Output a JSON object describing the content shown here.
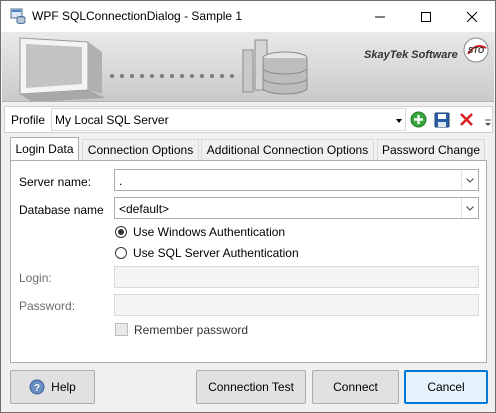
{
  "window": {
    "title": "WPF SQLConnectionDialog - Sample 1",
    "icon": "database-window-icon"
  },
  "banner": {
    "brand": "SkayTek Software",
    "logo_text": "STO"
  },
  "profile": {
    "label": "Profile",
    "value": "My Local SQL Server"
  },
  "tabs": [
    {
      "label": "Login Data",
      "active": true
    },
    {
      "label": "Connection Options",
      "active": false
    },
    {
      "label": "Additional Connection Options",
      "active": false
    },
    {
      "label": "Password Change",
      "active": false
    }
  ],
  "login": {
    "server_label": "Server name:",
    "server_value": ".",
    "database_label": "Database name",
    "database_value": "<default>",
    "auth_windows": "Use Windows Authentication",
    "auth_sql": "Use SQL Server Authentication",
    "login_label": "Login:",
    "login_value": "",
    "password_label": "Password:",
    "password_value": "",
    "remember_label": "Remember password"
  },
  "buttons": {
    "help": "Help",
    "test": "Connection Test",
    "connect": "Connect",
    "cancel": "Cancel"
  }
}
